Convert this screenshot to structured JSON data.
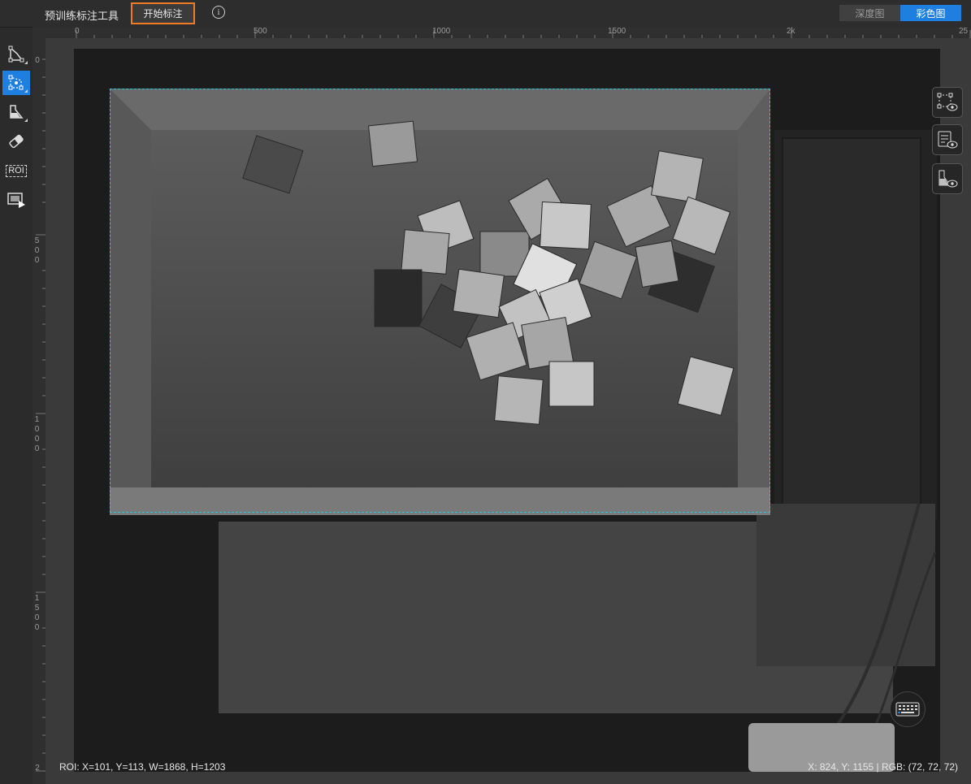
{
  "app": {
    "title": "预训练标注工具",
    "start_button": "开始标注",
    "info_icon": "info-icon"
  },
  "view_tabs": [
    {
      "label": "深度图",
      "active": false
    },
    {
      "label": "彩色图",
      "active": true
    }
  ],
  "toolbar": {
    "tools": [
      {
        "name": "polygon-tool-icon",
        "active": false
      },
      {
        "name": "point-polygon-tool-icon",
        "active": true
      },
      {
        "name": "mask-tool-icon",
        "active": false
      },
      {
        "name": "eraser-tool-icon",
        "active": false
      },
      {
        "name": "roi-tool-icon",
        "label": "ROI",
        "active": false
      },
      {
        "name": "play-frame-tool-icon",
        "active": false
      }
    ]
  },
  "ruler": {
    "top_labels": [
      "0",
      "500",
      "1000",
      "1500",
      "2k",
      "25"
    ],
    "left_labels": [
      "0",
      "500",
      "1000",
      "1500",
      "2"
    ]
  },
  "right_buttons": [
    "show-polygon-icon",
    "show-list-icon",
    "show-mask-icon"
  ],
  "status": {
    "roi": "ROI: X=101, Y=113, W=1868, H=1203",
    "cursor": "X: 824, Y: 1155 | RGB: (72, 72, 72)"
  },
  "colors": {
    "accent": "#1e7fe0",
    "highlight": "#f07a26",
    "roi": "#25c7d8"
  }
}
